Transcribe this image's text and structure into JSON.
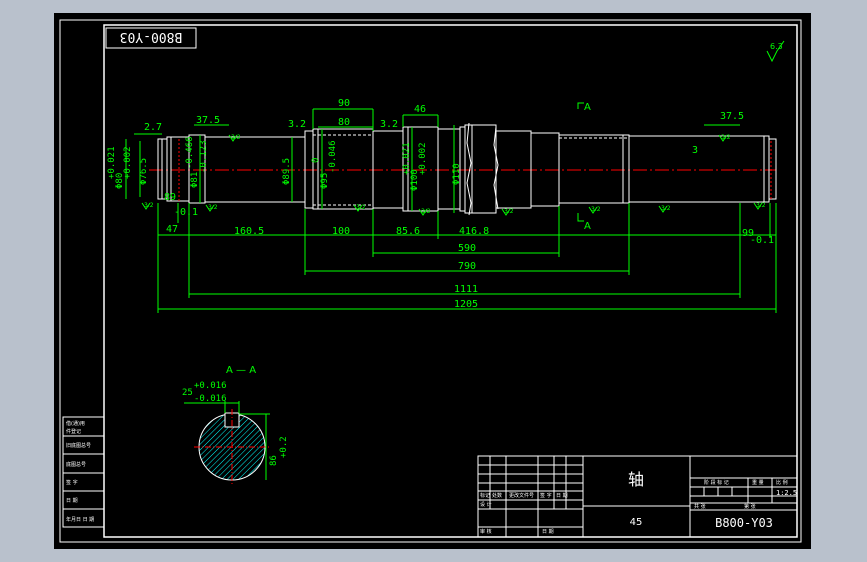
{
  "colors": {
    "background": "#000000",
    "outline": "#ffffff",
    "dimension": "#00ff00",
    "centerline": "#ff0000",
    "hatch": "#00ffff",
    "outer_bg": "#b9c1cc"
  },
  "drawing": {
    "title_block_code": "B800-Y03",
    "mirrored_code": "B800-Y03",
    "part_name": "轴",
    "material": "45",
    "scale": "1:2.5",
    "roughness_corner": "6.3"
  },
  "dims": {
    "d_left_end": "Φ80",
    "d_left_end_tol_up": "+0.021",
    "d_left_end_tol_dn": "+0.002",
    "d_76": "Φ76.5",
    "d_79": "Φ79",
    "d_81": "Φ81",
    "d_81_tol": "-0.123",
    "d_81_tol2": "-0.466",
    "d_89": "Φ89.5",
    "d_95": "Φ95",
    "d_95_tol": "-0.046",
    "d_95_tol2": "0",
    "d_100": "Φ100",
    "d_100_tol_up": "+0.021",
    "d_100_tol_dn": "+0.002",
    "d_110": "Φ110",
    "len_2_7": "2.7",
    "len_37_5_l": "37.5",
    "len_3_2_a": "3.2",
    "len_90": "90",
    "len_80": "80",
    "len_3_2_b": "3.2",
    "len_46": "46",
    "len_3_2_c": "3.2",
    "len_37_5_r": "37.5",
    "len_3_r": "3",
    "len_3_l": "3",
    "len_47": "47",
    "len_160_5": "160.5",
    "len_100": "100",
    "len_85_6": "85.6",
    "len_416_8": "416.8",
    "len_590": "590",
    "len_790": "790",
    "len_1111": "1111",
    "len_1205": "1205",
    "groove_l": "89",
    "groove_l_tol": "-0.1",
    "groove_r": "99",
    "groove_r_tol": "-0.1",
    "section_mark": "A",
    "section_title": "A — A",
    "key_width": "25",
    "key_tol_up": "+0.016",
    "key_tol_dn": "-0.016",
    "key_depth": "86",
    "key_depth_tol": "+0.2"
  },
  "roughness_marks": [
    "3.2",
    "3.2",
    "3.2",
    "3.2",
    "3.2",
    "3.2",
    "3.2",
    "3.2",
    "3.2",
    "3.2"
  ],
  "left_table": {
    "rows": [
      "借(通)用",
      "件登记",
      "旧底图总号",
      "底图总号",
      "签 字",
      "日 期",
      "年月日 日 期"
    ]
  },
  "title_block": {
    "header_cells": [
      "标记",
      "处数",
      "更改文件号",
      "签 字",
      "日 期"
    ],
    "left_rows": [
      "设 计",
      "审 核"
    ],
    "date_label": "日 期",
    "stage_headers": [
      "阶 段 标 记",
      "重 量",
      "比 例"
    ],
    "small_labels": [
      "共 张",
      "第 张"
    ]
  }
}
